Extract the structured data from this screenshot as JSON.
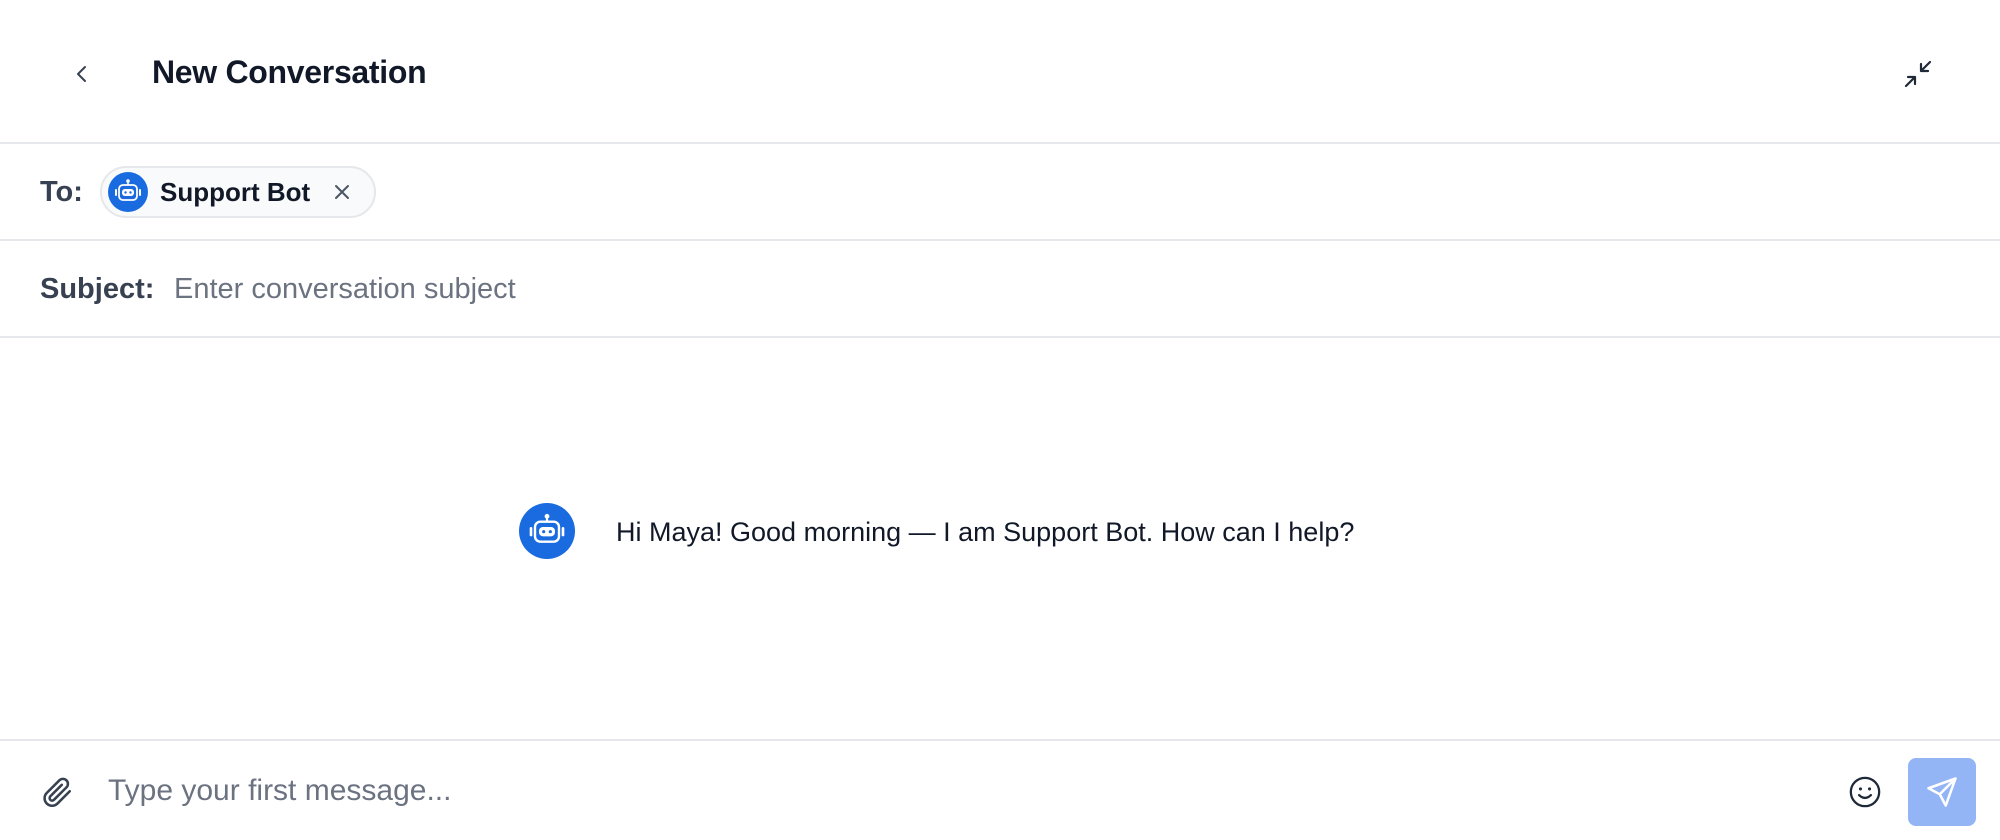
{
  "header": {
    "title": "New Conversation",
    "back_icon": "chevron-left-icon",
    "minimize_icon": "minimize-arrows-icon"
  },
  "recipients": {
    "label": "To:",
    "chips": [
      {
        "name": "Support Bot",
        "avatar_icon": "robot-icon",
        "remove_icon": "close-icon"
      }
    ]
  },
  "subject": {
    "label": "Subject:",
    "value": "",
    "placeholder": "Enter conversation subject"
  },
  "messages": [
    {
      "sender_icon": "robot-icon",
      "text": "Hi Maya! Good morning — I am Support Bot. How can I help?"
    }
  ],
  "composer": {
    "value": "",
    "placeholder": "Type your first message...",
    "attach_icon": "paperclip-icon",
    "emoji_icon": "smiley-icon",
    "send_icon": "send-icon"
  },
  "colors": {
    "accent": "#1a6be0",
    "send_button_disabled": "#93b4f5",
    "divider": "#e5e7eb",
    "text_primary": "#111827",
    "text_label": "#374151",
    "placeholder": "#6b7280"
  }
}
